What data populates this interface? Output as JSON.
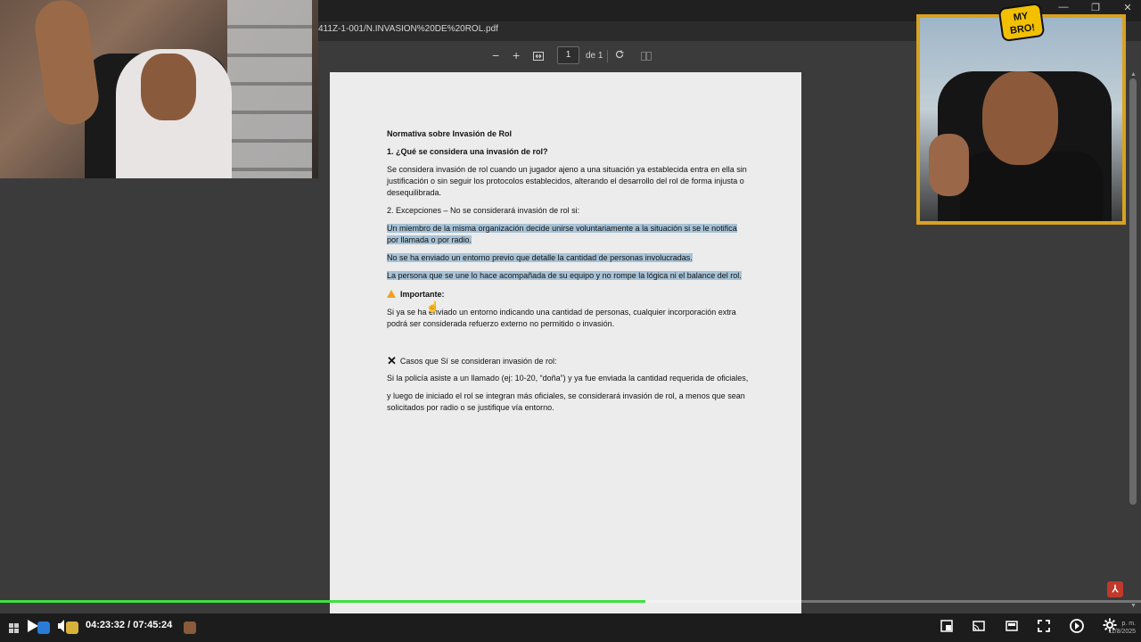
{
  "browser": {
    "url_fragment": "411Z-1-001/N.INVASION%20DE%20ROL.pdf",
    "window_controls": [
      "—",
      "❐",
      "✕"
    ]
  },
  "pdf_toolbar": {
    "zoom_out": "−",
    "zoom_in": "+",
    "fit_icon": "fit-page-icon",
    "page_number": "1",
    "page_of": "de 1",
    "rotate_icon": "rotate-icon"
  },
  "document": {
    "title": "Normativa sobre Invasión de Rol",
    "section1_heading": "1. ¿Qué se considera una invasión de rol?",
    "section1_body": " Se considera invasión de rol cuando un jugador ajeno a una situación ya establecida entra en ella sin justificación o sin seguir los protocolos establecidos, alterando el desarrollo del rol de forma injusta o desequilibrada.",
    "section2_heading": "2. Excepciones – No se considerará invasión de rol si:",
    "exception1": "Un miembro de la misma organización decide unirse voluntariamente a la situación  si se le notifica por llamada o por radio.",
    "exception2": "No se ha enviado un entorno previo que detalle la cantidad de personas involucradas.",
    "exception3": "La persona que se une lo hace acompañada de su equipo y no rompe la lógica ni el balance del rol.",
    "important_label": "Importante:",
    "important_body": " Si ya se ha enviado un entorno indicando una cantidad de personas, cualquier incorporación extra podrá ser considerada refuerzo externo no permitido o invasión.",
    "cases_heading": "Casos que Sí se consideran invasión de rol:",
    "case1": "Si la policía asiste a un llamado (ej: 10-20, “doña”) y ya fue enviada la cantidad requerida de oficiales,",
    "case2": " y luego de iniciado el rol se integran más oficiales, se considerará invasión de rol, a menos que sean solicitados por radio o se justifique vía entorno."
  },
  "overlay": {
    "badge_line1": "MY",
    "badge_line2": "BRO!"
  },
  "video": {
    "current_time": "04:23:32",
    "separator": "/",
    "total_time": "07:45:24",
    "progress_fraction": 0.566
  },
  "tray": {
    "time_suffix": "p. m.",
    "date": "11/8/2025"
  },
  "colors": {
    "highlight": "#a7c2d6",
    "progress": "#40e040",
    "frame": "#d9a21f"
  }
}
